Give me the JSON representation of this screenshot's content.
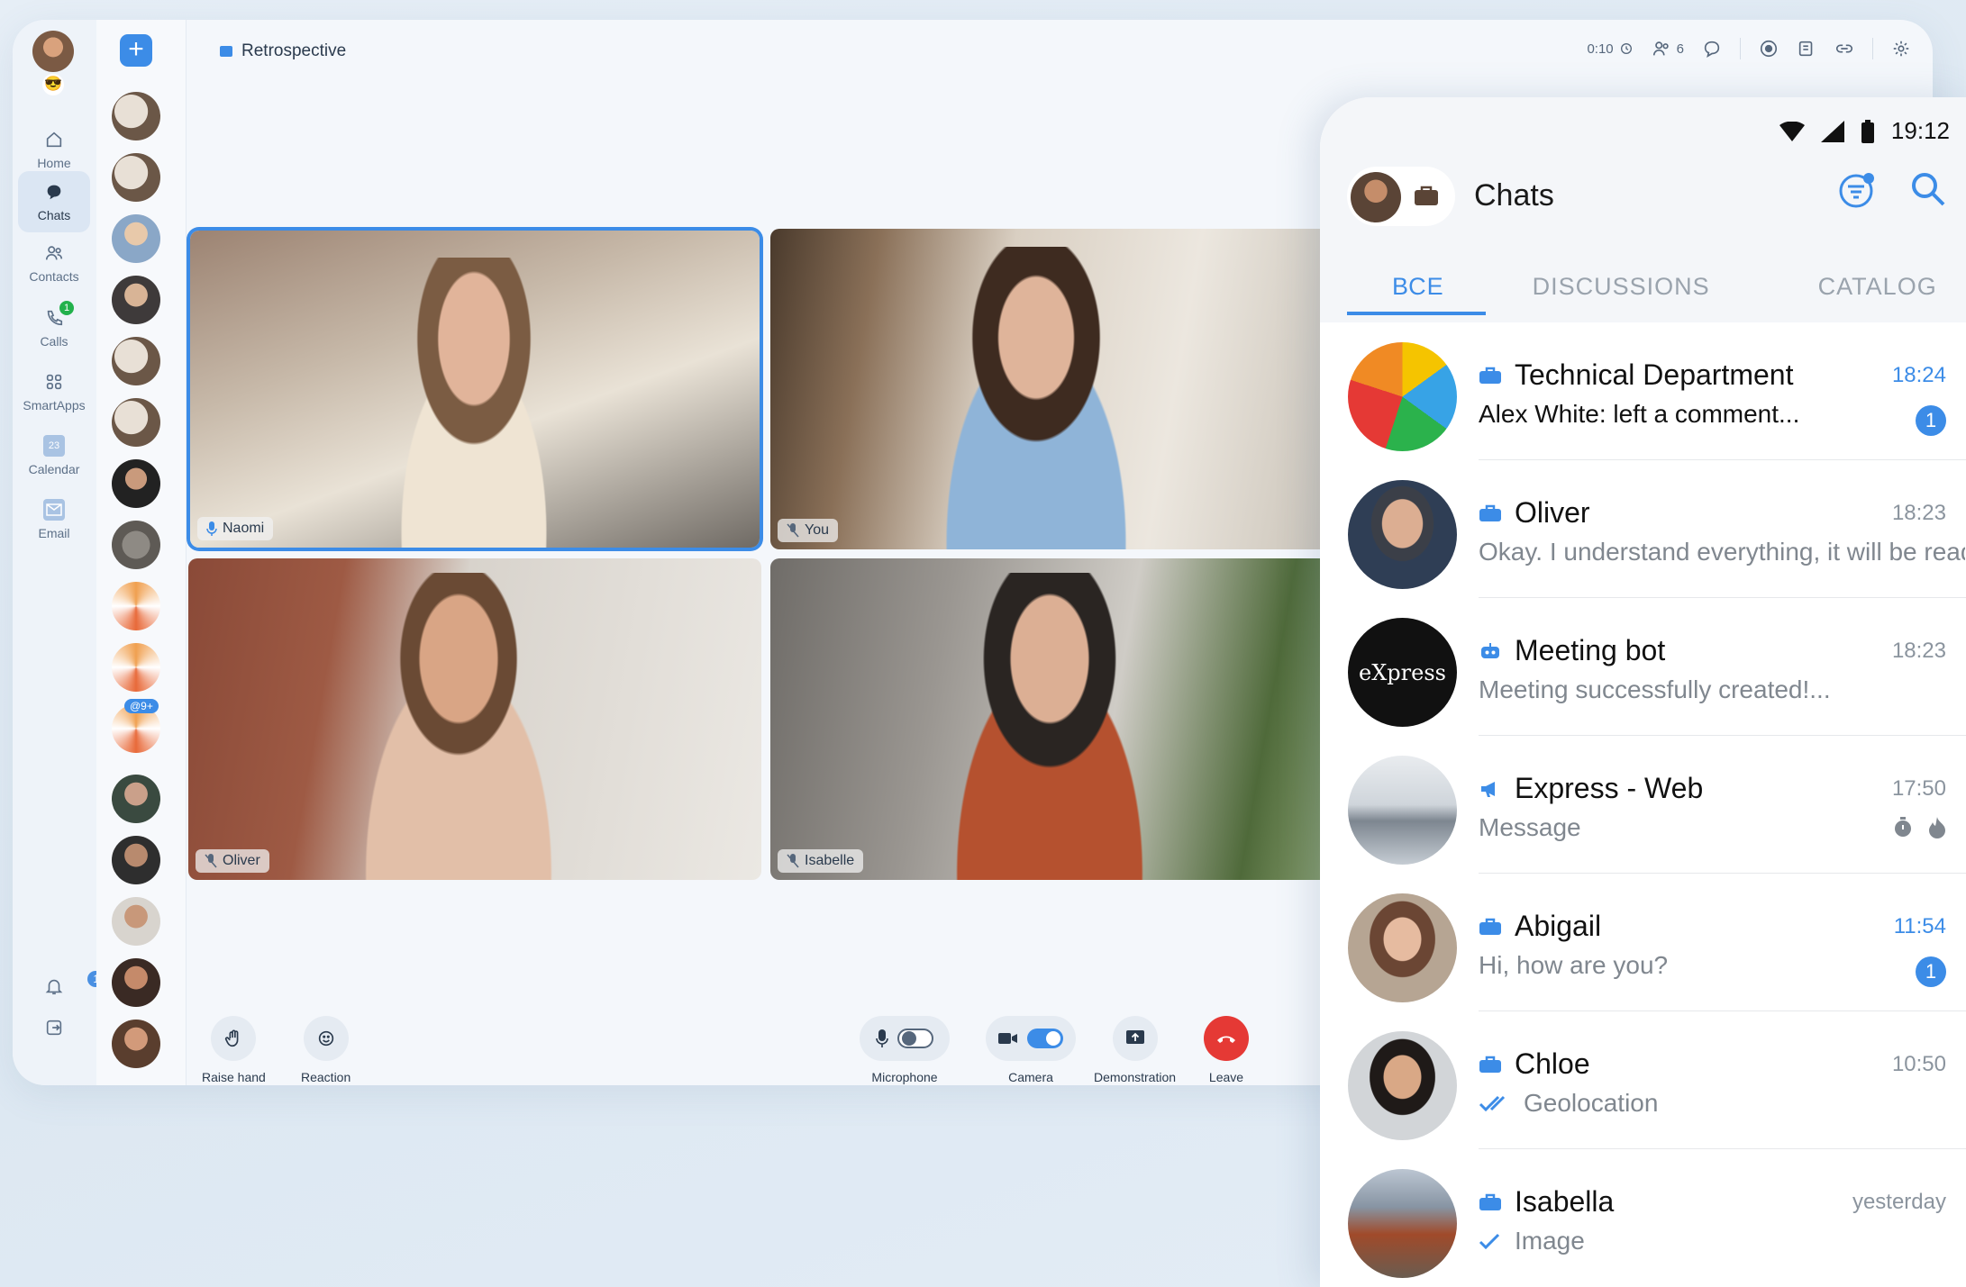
{
  "desktop": {
    "rail": {
      "status_emoji": "😎",
      "items": [
        {
          "label": "Home",
          "icon": "home-icon"
        },
        {
          "label": "Chats",
          "icon": "chat-bubble-icon",
          "active": true
        },
        {
          "label": "Contacts",
          "icon": "contacts-icon"
        },
        {
          "label": "Calls",
          "icon": "phone-icon",
          "badge": "1"
        },
        {
          "label": "SmartApps",
          "icon": "apps-grid-icon"
        },
        {
          "label": "Calendar",
          "icon": "calendar-icon",
          "calendar_day": "23"
        },
        {
          "label": "Email",
          "icon": "email-icon"
        }
      ],
      "notifications_badge": "12"
    },
    "strip": {
      "new_button": "+",
      "mention_tag": "@9+"
    },
    "topbar": {
      "title": "Retrospective",
      "timer": "0:10",
      "participants": "6"
    },
    "participants": [
      {
        "name": "Naomi",
        "speaking": true,
        "mic": "on"
      },
      {
        "name": "You",
        "speaking": false,
        "mic": "off"
      },
      {
        "name": "Oliver",
        "speaking": false,
        "mic": "off"
      },
      {
        "name": "Isabelle",
        "speaking": false,
        "mic": "off"
      }
    ],
    "controls": {
      "raise_hand": "Raise hand",
      "reaction": "Reaction",
      "microphone": "Microphone",
      "camera": "Camera",
      "demonstration": "Demonstration",
      "leave": "Leave"
    }
  },
  "phone": {
    "status_time": "19:12",
    "title": "Chats",
    "tabs": [
      "ВСЕ",
      "DISCUSSIONS",
      "CATALOG"
    ],
    "active_tab": 0,
    "chats": [
      {
        "title": "Technical Department",
        "time": "18:24",
        "time_highlight": true,
        "sender": "Alex White:",
        "preview": "left a comment...",
        "unread": "1",
        "type": "group"
      },
      {
        "title": "Oliver",
        "time": "18:23",
        "preview": "Okay. I understand everything, it will be ready",
        "type": "group"
      },
      {
        "title": "Meeting bot",
        "time": "18:23",
        "preview": "Meeting successfully created!...",
        "type": "bot",
        "avatar_text": "eXpress"
      },
      {
        "title": "Express - Web",
        "time": "17:50",
        "preview": "Message",
        "type": "channel",
        "flags": [
          "timer",
          "burn"
        ]
      },
      {
        "title": "Abigail",
        "time": "11:54",
        "time_highlight": true,
        "preview": "Hi, how are you?",
        "unread": "1",
        "type": "group"
      },
      {
        "title": "Chloe",
        "time": "10:50",
        "preview": "Geolocation",
        "type": "group",
        "check": "double"
      },
      {
        "title": "Isabella",
        "time": "yesterday",
        "preview": "Image",
        "type": "group",
        "check": "single"
      }
    ]
  },
  "colors": {
    "accent": "#3c8ce7",
    "leave": "#e53935",
    "badge_green": "#22b14c"
  }
}
